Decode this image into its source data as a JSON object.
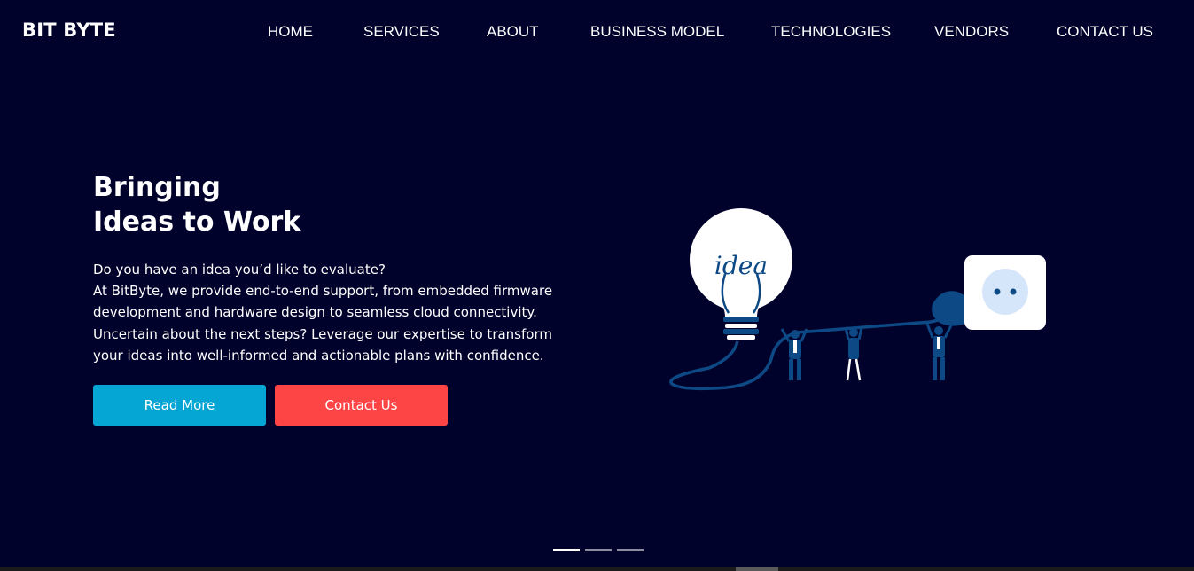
{
  "brand": {
    "name": "BIT BYTE"
  },
  "nav": {
    "items": [
      {
        "label": "HOME"
      },
      {
        "label": "SERVICES"
      },
      {
        "label": "ABOUT"
      },
      {
        "label": "BUSINESS MODEL"
      },
      {
        "label": "TECHNOLOGIES"
      },
      {
        "label": "VENDORS"
      },
      {
        "label": "CONTACT US"
      }
    ]
  },
  "hero": {
    "title_line1": "Bringing",
    "title_line2": "Ideas to Work",
    "text_lines": [
      "Do you have an idea you’d like to evaluate?",
      "At BitByte, we provide end-to-end support, from embedded firmware",
      "development and hardware design to seamless cloud connectivity.",
      "Uncertain about the next steps? Leverage our expertise to transform",
      "your ideas into well-informed and actionable plans with confidence."
    ],
    "read_more_label": "Read More",
    "contact_label": "Contact Us",
    "illustration_text": "idea"
  },
  "slider": {
    "count": 3,
    "active": 1
  },
  "colors": {
    "background": "#01022b",
    "read_more": "#06a6d4",
    "contact": "#fd4546",
    "illustration_blue": "#0d4a85",
    "bulb_white": "#ffffff",
    "socket_face": "#d6e6fa"
  },
  "icons": {
    "illustration": "lightbulb-plug-illustration"
  }
}
